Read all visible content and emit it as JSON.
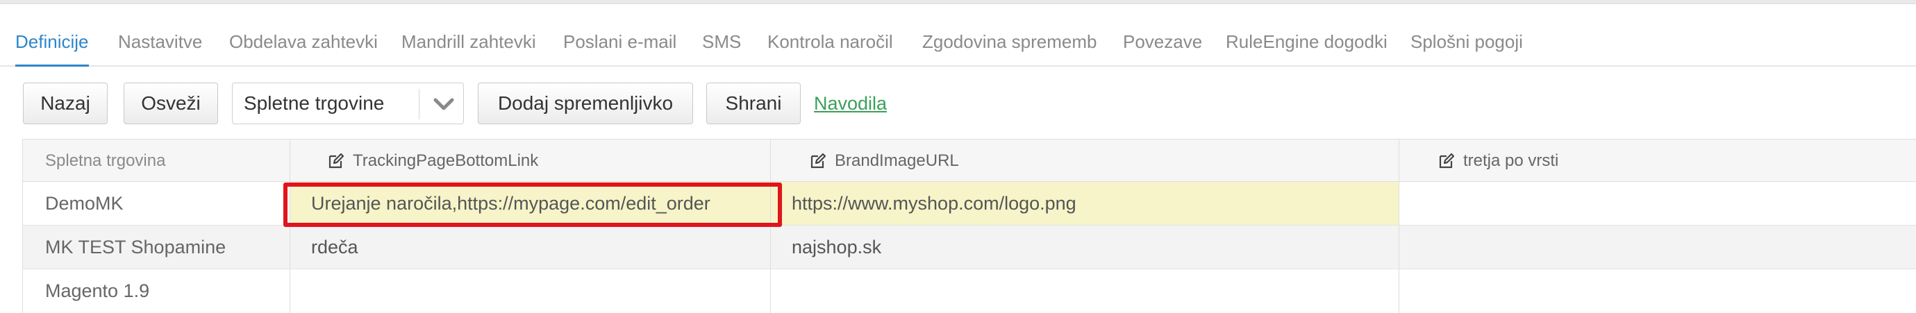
{
  "tabs": [
    {
      "label": "Definicije",
      "active": true
    },
    {
      "label": "Nastavitve"
    },
    {
      "label": "Obdelava zahtevki"
    },
    {
      "label": "Mandrill zahtevki"
    },
    {
      "label": "Poslani e-mail"
    },
    {
      "label": "SMS"
    },
    {
      "label": "Kontrola naročil"
    },
    {
      "label": "Zgodovina sprememb"
    },
    {
      "label": "Povezave"
    },
    {
      "label": "RuleEngine dogodki"
    },
    {
      "label": "Splošni pogoji"
    }
  ],
  "toolbar": {
    "back_label": "Nazaj",
    "refresh_label": "Osveži",
    "store_select_value": "Spletne trgovine",
    "add_variable_label": "Dodaj spremenljivko",
    "save_label": "Shrani",
    "instructions_link": "Navodila"
  },
  "table": {
    "columns": [
      "Spletna trgovina",
      "TrackingPageBottomLink",
      "BrandImageURL",
      "tretja po vrsti"
    ],
    "rows": [
      [
        "DemoMK",
        "Urejanje naročila,https://mypage.com/edit_order",
        "https://www.myshop.com/logo.png",
        ""
      ],
      [
        "MK TEST Shopamine",
        "rdeča",
        "najshop.sk",
        ""
      ],
      [
        "Magento 1.9",
        "",
        "",
        ""
      ]
    ]
  },
  "colors": {
    "accent": "#2e86c9",
    "link": "#3aa05a",
    "highlight_cell": "#f6f4c8",
    "annotation_box": "#e0141c"
  }
}
